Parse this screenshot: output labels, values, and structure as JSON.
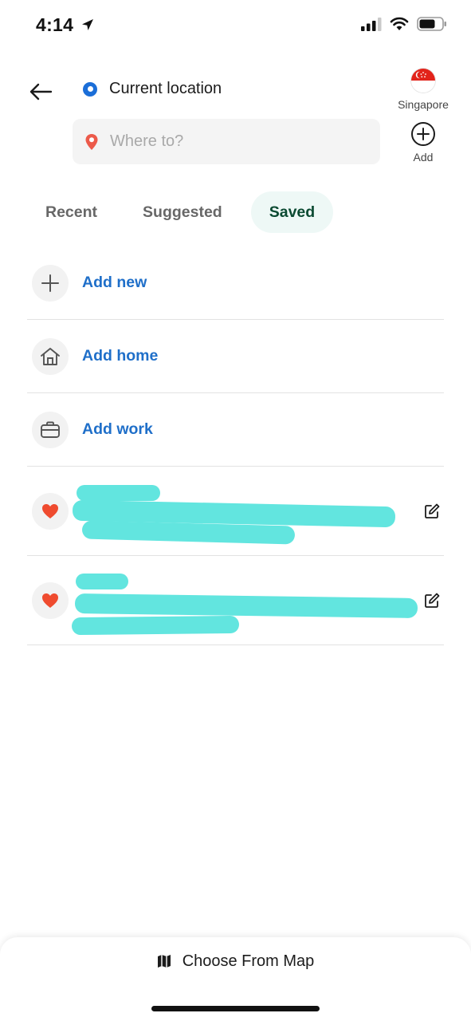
{
  "status_bar": {
    "time": "4:14"
  },
  "header": {
    "origin": {
      "label": "Current location"
    },
    "destination": {
      "placeholder": "Where to?",
      "value": ""
    },
    "region": {
      "label": "Singapore"
    },
    "add_stop": {
      "label": "Add"
    }
  },
  "tabs": [
    {
      "label": "Recent",
      "active": false
    },
    {
      "label": "Suggested",
      "active": false
    },
    {
      "label": "Saved",
      "active": true
    }
  ],
  "saved_actions": [
    {
      "label": "Add new",
      "icon": "plus-icon"
    },
    {
      "label": "Add home",
      "icon": "home-icon"
    },
    {
      "label": "Add work",
      "icon": "briefcase-icon"
    }
  ],
  "saved_places": [
    {
      "icon": "heart-icon",
      "redacted": true
    },
    {
      "icon": "heart-icon",
      "redacted": true
    }
  ],
  "bottom": {
    "map_button": "Choose From Map"
  },
  "colors": {
    "accent_blue": "#1f6fc9",
    "active_tab_bg": "#eef8f6",
    "active_tab_text": "#0b4a32",
    "heart": "#ef4b2f",
    "redaction": "#62e5df"
  }
}
